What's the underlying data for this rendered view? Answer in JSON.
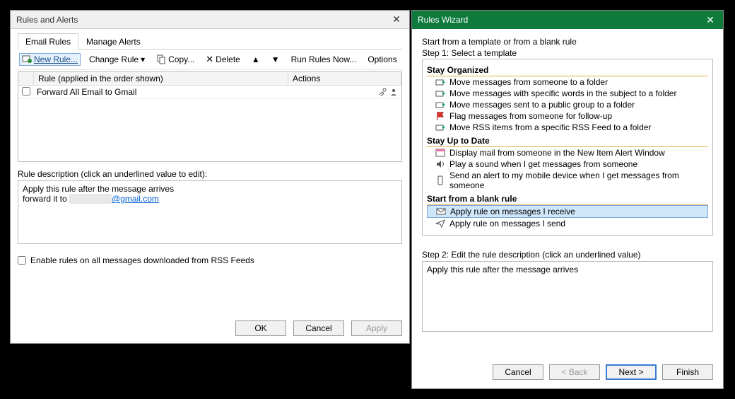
{
  "rules_dialog": {
    "title": "Rules and Alerts",
    "tabs": {
      "email_rules": "Email Rules",
      "manage_alerts": "Manage Alerts"
    },
    "toolbar": {
      "new_rule": "New Rule...",
      "change_rule": "Change Rule",
      "copy": "Copy...",
      "delete": "Delete",
      "run_rules": "Run Rules Now...",
      "options": "Options"
    },
    "list": {
      "col_rule": "Rule (applied in the order shown)",
      "col_actions": "Actions",
      "rows": [
        {
          "name": "Forward All Email to Gmail"
        }
      ]
    },
    "desc_label": "Rule description (click an underlined value to edit):",
    "desc_line1": "Apply this rule after the message arrives",
    "desc_line2_prefix": "forward it to ",
    "desc_email_suffix": "@gmail.com",
    "rss_checkbox": "Enable rules on all messages downloaded from RSS Feeds",
    "buttons": {
      "ok": "OK",
      "cancel": "Cancel",
      "apply": "Apply"
    }
  },
  "wizard": {
    "title": "Rules Wizard",
    "intro": "Start from a template or from a blank rule",
    "step1": "Step 1: Select a template",
    "sec_organized": "Stay Organized",
    "organized": [
      "Move messages from someone to a folder",
      "Move messages with specific words in the subject to a folder",
      "Move messages sent to a public group to a folder",
      "Flag messages from someone for follow-up",
      "Move RSS items from a specific RSS Feed to a folder"
    ],
    "sec_uptodate": "Stay Up to Date",
    "uptodate": [
      "Display mail from someone in the New Item Alert Window",
      "Play a sound when I get messages from someone",
      "Send an alert to my mobile device when I get messages from someone"
    ],
    "sec_blank": "Start from a blank rule",
    "blank": [
      "Apply rule on messages I receive",
      "Apply rule on messages I send"
    ],
    "step2_label": "Step 2: Edit the rule description (click an underlined value)",
    "step2_text": "Apply this rule after the message arrives",
    "buttons": {
      "cancel": "Cancel",
      "back": "< Back",
      "next": "Next >",
      "finish": "Finish"
    }
  }
}
